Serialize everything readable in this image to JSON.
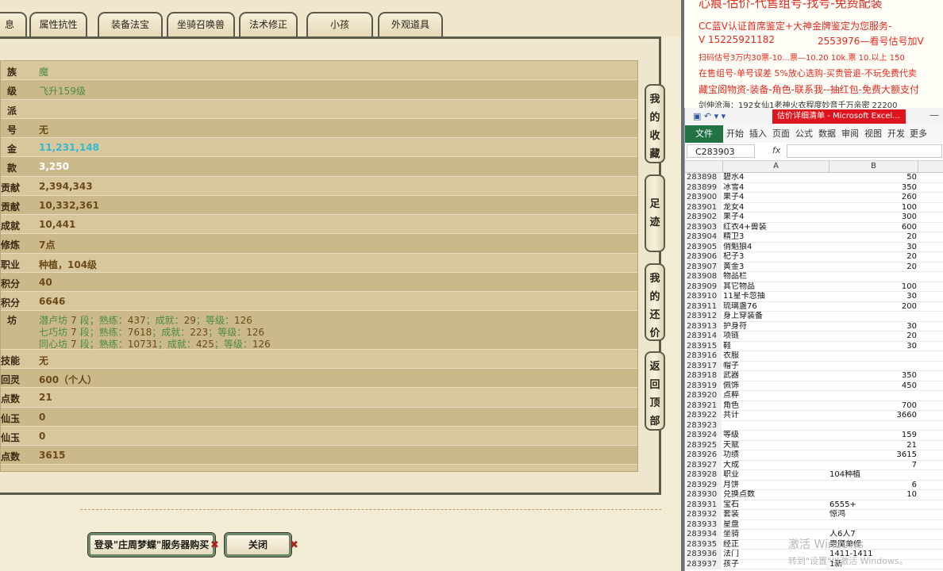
{
  "tabs": [
    {
      "label": "息"
    },
    {
      "label": "属性抗性"
    },
    {
      "label": "装备法宝"
    },
    {
      "label": "坐骑召唤兽"
    },
    {
      "label": "法术修正"
    },
    {
      "label": "小孩"
    },
    {
      "label": "外观道具"
    }
  ],
  "rows": [
    {
      "label": "族",
      "value": "魔"
    },
    {
      "label": "级",
      "value": "飞升159级"
    },
    {
      "label": "派",
      "value": ""
    },
    {
      "label": "号",
      "value": "无"
    },
    {
      "label": "金",
      "value": "11,231,148"
    },
    {
      "label": "款",
      "value": "3,250"
    },
    {
      "label": "贡献",
      "value": "2,394,343"
    },
    {
      "label": "贡献",
      "value": "10,332,361"
    },
    {
      "label": "成就",
      "value": "10,441"
    },
    {
      "label": "修炼",
      "value": "7点"
    },
    {
      "label": "职业",
      "value": "种植，104级"
    },
    {
      "label": "积分",
      "value": "40"
    },
    {
      "label": "积分",
      "value": "6646"
    },
    {
      "label": "坊",
      "lines": [
        {
          "name": "潜卢坊",
          "seg": "7",
          "shulian": "437",
          "chengjiu": "29",
          "dengji": "126"
        },
        {
          "name": "七巧坊",
          "seg": "7",
          "shulian": "7618",
          "chengjiu": "223",
          "dengji": "126"
        },
        {
          "name": "同心坊",
          "seg": "7",
          "shulian": "10731",
          "chengjiu": "425",
          "dengji": "126"
        }
      ]
    },
    {
      "label": "技能",
      "value": "无"
    },
    {
      "label": "回灵",
      "value": "600（个人）"
    },
    {
      "label": "点数",
      "value": "21"
    },
    {
      "label": "仙玉",
      "value": "0"
    },
    {
      "label": "仙玉",
      "value": "0"
    },
    {
      "label": "点数",
      "value": "3615"
    }
  ],
  "workshop_words": {
    "seg": "段",
    "shulian": "熟练：",
    "chengjiu": "成就：",
    "dengji": "等级："
  },
  "side_buttons": [
    {
      "chars": [
        "我",
        "的",
        "收",
        "藏"
      ]
    },
    {
      "chars": [
        "足",
        "迹"
      ]
    },
    {
      "chars": [
        "我",
        "的",
        "还",
        "价"
      ]
    },
    {
      "chars": [
        "返",
        "回",
        "顶",
        "部"
      ]
    }
  ],
  "bottom": {
    "buy_label": "登录\"庄周梦蝶\"服务器购买",
    "close_label": "关闭",
    "x_glyph": "✖"
  },
  "ad": {
    "line1": "心痕-估价-代售组号-找号-免费配装",
    "line2": "CC蓝V认证首席鉴定+大神金牌鉴定为您服务-",
    "line3a": "V 15225921182",
    "line3b": "2553976—看号估号加V",
    "line4": "扫码估号3万内30票-10...票—10.20 10k.票 10.以上 150",
    "line5": "在售组号-单号误差 5%放心选购-买贵管退-不玩免费代卖",
    "line6": "藏宝阁物资-装备-角色-联系我--抽红包-免费大额支付",
    "line7": "剑伸沧海：192女仙1老神火衣程度妙音千万亲密 22200"
  },
  "excel": {
    "title": "估价详细清单 - Microsoft Excel...",
    "ribbon_tabs": [
      "文件",
      "开始",
      "插入",
      "页面",
      "公式",
      "数据",
      "审阅",
      "视图",
      "开发",
      "更多"
    ],
    "namebox": "C283903",
    "fx": "fx",
    "col_a": "A",
    "col_b": "B",
    "rows": [
      [
        "283898",
        "碧水4",
        "50"
      ],
      [
        "283899",
        "冰雪4",
        "350"
      ],
      [
        "283900",
        "果子4",
        "260"
      ],
      [
        "283901",
        "龙女4",
        "100"
      ],
      [
        "283902",
        "果子4",
        "300"
      ],
      [
        "283903",
        "红衣4+兽装",
        "600"
      ],
      [
        "283904",
        "精卫3",
        "20"
      ],
      [
        "283905",
        "俏魁狼4",
        "30"
      ],
      [
        "283906",
        "杞子3",
        "20"
      ],
      [
        "283907",
        "黄金3",
        "20"
      ],
      [
        "283908",
        "物品栏",
        ""
      ],
      [
        "283909",
        "其它物品",
        "100"
      ],
      [
        "283910",
        "11星卡忽抽",
        "30"
      ],
      [
        "283911",
        "琉璃盏76",
        "200"
      ],
      [
        "283912",
        "身上穿装备",
        ""
      ],
      [
        "283913",
        "护身符",
        "30"
      ],
      [
        "283914",
        "项链",
        "20"
      ],
      [
        "283915",
        "鞋",
        "30"
      ],
      [
        "283916",
        "衣服",
        ""
      ],
      [
        "283917",
        "帽子",
        ""
      ],
      [
        "283918",
        "武器",
        "350"
      ],
      [
        "283919",
        "佩饰",
        "450"
      ],
      [
        "283920",
        "点粹",
        ""
      ],
      [
        "283921",
        "角色",
        "700"
      ],
      [
        "283922",
        "共计",
        "3660"
      ],
      [
        "283923",
        "",
        ""
      ],
      [
        "283924",
        "等级",
        "159"
      ],
      [
        "283925",
        "天赋",
        "21"
      ],
      [
        "283926",
        "功绩",
        "3615"
      ],
      [
        "283927",
        "大成",
        "7"
      ],
      [
        "283928",
        "职业",
        "104种植"
      ],
      [
        "283929",
        "月饼",
        "6"
      ],
      [
        "283930",
        "兑换点数",
        "10"
      ],
      [
        "283931",
        "宝石",
        "6555+"
      ],
      [
        "283932",
        "套装",
        "惊鸿"
      ],
      [
        "283933",
        "星盘",
        ""
      ],
      [
        "283934",
        "坐骑",
        "人6人7"
      ],
      [
        "283935",
        "经正",
        "男魔单修"
      ],
      [
        "283936",
        "法门",
        "1411-1411"
      ],
      [
        "283937",
        "孩子",
        "1新"
      ]
    ],
    "watermark1": "激活 Windows",
    "watermark2": "转到\"设置\"以激活 Windows。"
  }
}
